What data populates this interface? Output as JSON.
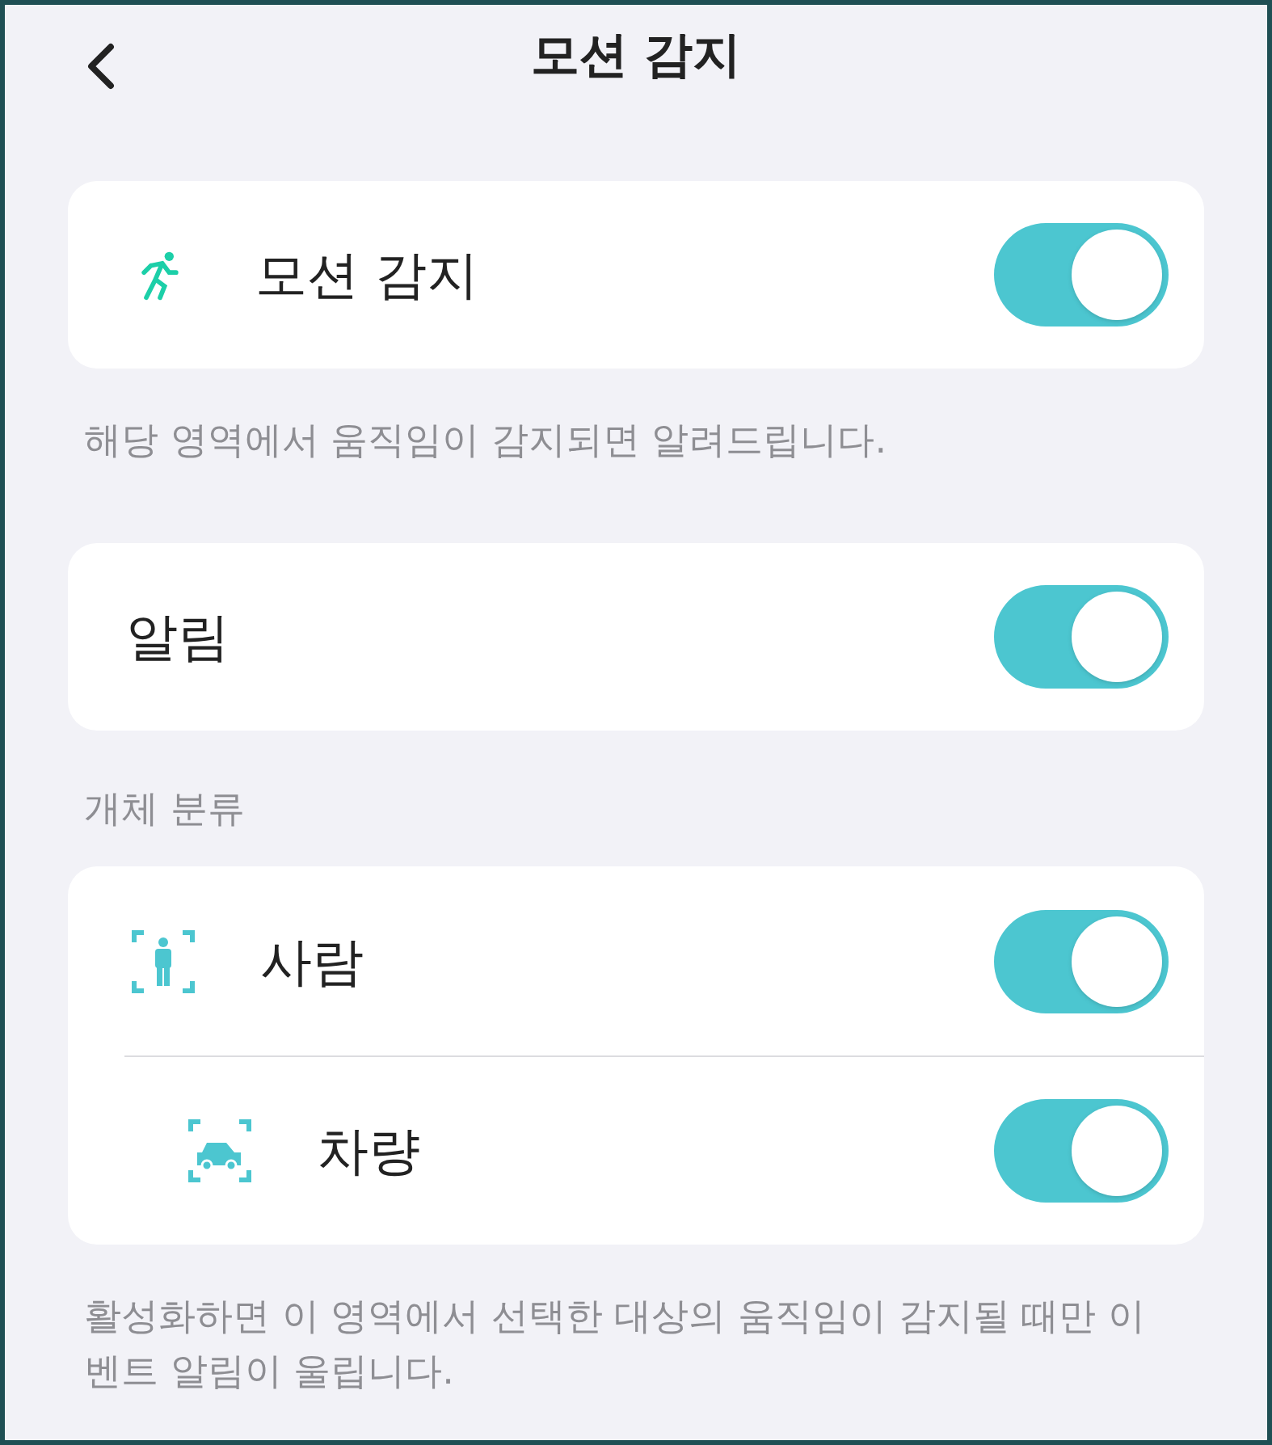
{
  "header": {
    "title": "모션 감지"
  },
  "motion": {
    "label": "모션 감지",
    "on": true,
    "note": "해당 영역에서 움직임이 감지되면 알려드립니다."
  },
  "alert": {
    "label": "알림",
    "on": true
  },
  "classification": {
    "heading": "개체 분류",
    "items": [
      {
        "kind": "person",
        "label": "사람",
        "on": true
      },
      {
        "kind": "vehicle",
        "label": "차량",
        "on": true
      }
    ],
    "note": "활성화하면 이 영역에서 선택한 대상의 움직임이 감지될 때만 이벤트 알림이 울립니다."
  }
}
